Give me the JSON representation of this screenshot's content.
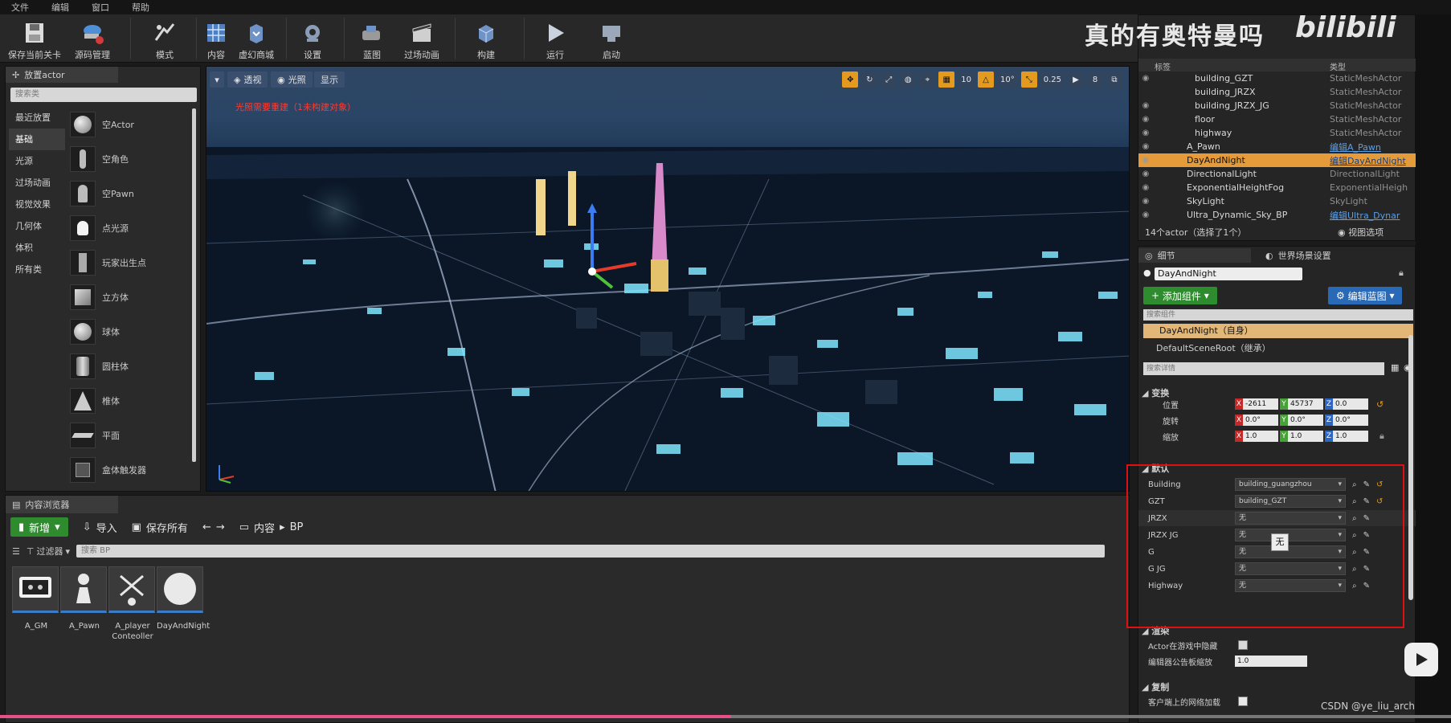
{
  "menu": [
    "文件",
    "编辑",
    "窗口",
    "帮助"
  ],
  "toolbar": [
    {
      "label": "保存当前关卡",
      "icon": "save-icon"
    },
    {
      "label": "源码管理",
      "icon": "source-control-icon"
    },
    {
      "label": "模式",
      "icon": "modes-icon"
    },
    {
      "label": "内容",
      "icon": "content-icon"
    },
    {
      "label": "虚幻商城",
      "icon": "marketplace-icon"
    },
    {
      "label": "设置",
      "icon": "settings-icon"
    },
    {
      "label": "蓝图",
      "icon": "blueprint-icon"
    },
    {
      "label": "过场动画",
      "icon": "cinematics-icon"
    },
    {
      "label": "构建",
      "icon": "build-icon"
    },
    {
      "label": "运行",
      "icon": "play-icon"
    },
    {
      "label": "启动",
      "icon": "launch-icon"
    }
  ],
  "place_panel": {
    "tab": "放置actor",
    "search_placeholder": "搜索类",
    "categories": [
      "最近放置",
      "基础",
      "光源",
      "过场动画",
      "视觉效果",
      "几何体",
      "体积",
      "所有类"
    ],
    "active_category": "基础",
    "items": [
      "空Actor",
      "空角色",
      "空Pawn",
      "点光源",
      "玩家出生点",
      "立方体",
      "球体",
      "圆柱体",
      "椎体",
      "平面",
      "盒体触发器"
    ]
  },
  "viewport": {
    "perspective": "透视",
    "lit": "光照",
    "show": "显示",
    "warning": "光照需要重建（1未构建对象）",
    "grid_snap": "10",
    "rot_snap": "10°",
    "scale_snap": "0.25",
    "camera_speed": "8"
  },
  "content_browser": {
    "tab": "内容浏览器",
    "add_new": "新增",
    "import": "导入",
    "save_all": "保存所有",
    "path_root": "内容",
    "path_folder": "BP",
    "filter": "过滤器",
    "search_placeholder": "搜索 BP",
    "assets": [
      "A_GM",
      "A_Pawn",
      "A_player Conteoller",
      "DayAndNight"
    ]
  },
  "outliner": {
    "col_label": "标签",
    "col_type": "类型",
    "rows": [
      {
        "name": "building_GZT",
        "type": "StaticMeshActor"
      },
      {
        "name": "building_JRZX",
        "type": "StaticMeshActor"
      },
      {
        "name": "building_JRZX_JG",
        "type": "StaticMeshActor"
      },
      {
        "name": "floor",
        "type": "StaticMeshActor"
      },
      {
        "name": "highway",
        "type": "StaticMeshActor"
      },
      {
        "name": "A_Pawn",
        "type": "编辑A_Pawn"
      },
      {
        "name": "DayAndNight",
        "type": "编辑DayAndNight"
      },
      {
        "name": "DirectionalLight",
        "type": "DirectionalLight"
      },
      {
        "name": "ExponentialHeightFog",
        "type": "ExponentialHeigh"
      },
      {
        "name": "SkyLight",
        "type": "SkyLight"
      },
      {
        "name": "Ultra_Dynamic_Sky_BP",
        "type": "编辑Ultra_Dynar"
      }
    ],
    "footer": "14个actor（选择了1个）",
    "view_options": "视图选项"
  },
  "watermark": "真的有奥特曼吗",
  "bili_logo": "bilibili",
  "details": {
    "tab_details": "细节",
    "tab_world": "世界场景设置",
    "actor_name": "DayAndNight",
    "add_component": "添加组件",
    "edit_blueprint": "编辑蓝图",
    "search_components": "搜索组件",
    "self_row": "DayAndNight（自身）",
    "root_row": "DefaultSceneRoot（继承）",
    "search_details": "搜索详情",
    "transform_header": "变换",
    "location_label": "位置",
    "rotation_label": "旋转",
    "scale_label": "缩放",
    "location": [
      "-2611",
      "45737",
      "0.0"
    ],
    "rotation": [
      "0.0°",
      "0.0°",
      "0.0°"
    ],
    "scale": [
      "1.0",
      "1.0",
      "1.0"
    ],
    "default_header": "默认",
    "props": [
      {
        "label": "Building",
        "value": "building_guangzhou"
      },
      {
        "label": "GZT",
        "value": "building_GZT"
      },
      {
        "label": "JRZX",
        "value": "无"
      },
      {
        "label": "JRZX JG",
        "value": "无"
      },
      {
        "label": "G",
        "value": "无"
      },
      {
        "label": "G JG",
        "value": "无"
      },
      {
        "label": "Highway",
        "value": "无"
      }
    ],
    "tooltip": "无",
    "render_header": "渲染",
    "hidden_in_game": "Actor在游戏中隐藏",
    "billboard_scale_label": "编辑器公告板缩放",
    "billboard_scale": "1.0",
    "replication_header": "复制",
    "net_load": "客户端上的网络加载"
  },
  "csdn": "CSDN @ye_liu_arch"
}
